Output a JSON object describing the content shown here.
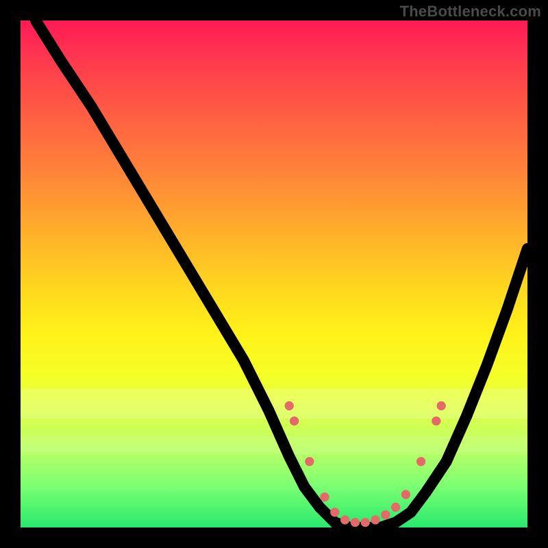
{
  "watermark": "TheBottleneck.com",
  "colors": {
    "frame": "#000000",
    "curve": "#000000",
    "dot": "#e36a68"
  },
  "chart_data": {
    "type": "line",
    "title": "",
    "xlabel": "",
    "ylabel": "",
    "xlim": [
      0,
      100
    ],
    "ylim": [
      0,
      100
    ],
    "grid": false,
    "series": [
      {
        "name": "bottleneck-curve",
        "x": [
          3,
          8,
          14,
          20,
          26,
          32,
          38,
          44,
          49,
          53,
          56,
          59,
          62,
          65,
          68,
          71,
          74,
          77,
          80,
          84,
          88,
          92,
          96,
          100
        ],
        "y": [
          100,
          92,
          83,
          73,
          63,
          53,
          43,
          33,
          23,
          14,
          8,
          4,
          1,
          0,
          0,
          0,
          1,
          3,
          7,
          13,
          22,
          32,
          43,
          55
        ]
      }
    ],
    "annotations": {
      "dots": [
        {
          "x": 53,
          "y": 24
        },
        {
          "x": 54,
          "y": 21
        },
        {
          "x": 57,
          "y": 13
        },
        {
          "x": 60,
          "y": 6
        },
        {
          "x": 62,
          "y": 3
        },
        {
          "x": 64,
          "y": 1.5
        },
        {
          "x": 66,
          "y": 1
        },
        {
          "x": 68,
          "y": 1
        },
        {
          "x": 70,
          "y": 1.5
        },
        {
          "x": 72,
          "y": 2.5
        },
        {
          "x": 74,
          "y": 4
        },
        {
          "x": 76,
          "y": 6.5
        },
        {
          "x": 79,
          "y": 13
        },
        {
          "x": 82,
          "y": 21
        },
        {
          "x": 83,
          "y": 24
        }
      ]
    }
  }
}
